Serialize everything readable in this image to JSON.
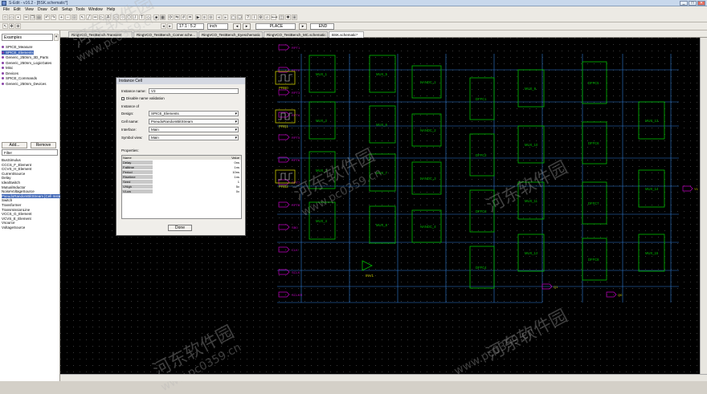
{
  "window": {
    "title": "S-Edit - v16.2 - [BSK.schematic*]",
    "min": "_",
    "max": "□",
    "close": "✕"
  },
  "menu": [
    "File",
    "Edit",
    "View",
    "Draw",
    "Cell",
    "Setup",
    "Tools",
    "Window",
    "Help"
  ],
  "toolbar": {
    "zoom_value": "17.1 : 5.2",
    "unit": "inch",
    "place_label": "PLACE",
    "end_label": "END"
  },
  "library": {
    "selected": "Examples",
    "tree": [
      {
        "label": "SPICE_Measure",
        "selected": false
      },
      {
        "label": "SPICE_Elements",
        "selected": true
      },
      {
        "label": "Generic_250nm_3D_Parts",
        "selected": false
      },
      {
        "label": "Generic_250nm_LogicGates",
        "selected": false
      },
      {
        "label": "Misc",
        "selected": false
      },
      {
        "label": "Devices",
        "selected": false
      },
      {
        "label": "SPICE_Commands",
        "selected": false
      },
      {
        "label": "Generic_250nm_Devices",
        "selected": false
      }
    ],
    "add_label": "Add...",
    "remove_label": "Remove",
    "filter_placeholder": "Filter",
    "cells": [
      {
        "label": "BusSimulus",
        "selected": false
      },
      {
        "label": "CCCS_F_Element",
        "selected": false
      },
      {
        "label": "CCVS_H_Element",
        "selected": false
      },
      {
        "label": "CurrentSource",
        "selected": false
      },
      {
        "label": "Delay",
        "selected": false
      },
      {
        "label": "IdealSwitch",
        "selected": false
      },
      {
        "label": "MutualInductor",
        "selected": false
      },
      {
        "label": "NoiseVoltageSource",
        "selected": false
      },
      {
        "label": "PseudoRandomBitStream [Cell Instance]",
        "selected": true
      },
      {
        "label": "Switch",
        "selected": false
      },
      {
        "label": "Transformer",
        "selected": false
      },
      {
        "label": "TransmissionLine",
        "selected": false
      },
      {
        "label": "VCCS_G_Element",
        "selected": false
      },
      {
        "label": "VCVS_E_Element",
        "selected": false
      },
      {
        "label": "Vsource",
        "selected": false
      },
      {
        "label": "VoltageSource",
        "selected": false
      }
    ]
  },
  "tabs": [
    {
      "label": "RingVCO_TestBench.Transient",
      "active": false
    },
    {
      "label": "RingVCO_TestBench_Corner.sche...",
      "active": false
    },
    {
      "label": "RingVCO_TestBench_Eyeschematic",
      "active": false
    },
    {
      "label": "RingVCO_TestBench_MC.schematic",
      "active": false
    },
    {
      "label": "BSK.schematic*",
      "active": true
    }
  ],
  "dialog": {
    "title": "Instance Cell",
    "instance_name_label": "Instance name:",
    "instance_name_value": "V3",
    "disable_validation_label": "Disable name validation",
    "instance_of_label": "Instance of",
    "design_label": "Design:",
    "design_value": "SPICE_Elements",
    "cell_name_label": "Cell name:",
    "cell_name_value": "PseudoRandomBitStream",
    "interface_label": "Interface:",
    "interface_value": "Main",
    "symbol_view_label": "Symbol view:",
    "symbol_view_value": "Main",
    "properties_label": "Properties:",
    "prop_header_name": "Name",
    "prop_header_value": "Value",
    "properties": [
      {
        "name": "Delay",
        "value": "0ns"
      },
      {
        "name": "Falltime",
        "value": "1ns"
      },
      {
        "name": "Period",
        "value": "10ns"
      },
      {
        "name": "Risetime",
        "value": "1ns"
      },
      {
        "name": "Seed",
        "value": "1"
      },
      {
        "name": "VHigh",
        "value": "5v"
      },
      {
        "name": "VLow",
        "value": "0v"
      }
    ],
    "done_label": "Done"
  },
  "schematic": {
    "inputs": [
      "RPT1",
      "RPT2",
      "RPT3",
      "RPT4",
      "RPT5",
      "RPT6",
      "RPT7",
      "RPT8",
      "SB0",
      "CLK",
      "SCLK",
      "SCLKR"
    ],
    "sources": [
      "PRB0",
      "PRB1",
      "PRB2"
    ],
    "mux": [
      "MUX_1",
      "MUX_2",
      "MUX_3",
      "MUX_4",
      "MUX_5",
      "MUX_6",
      "MUX_7",
      "MUX_8",
      "MUX_9",
      "MUX_10",
      "MUX_11",
      "MUX_12",
      "MUX_13",
      "MUX_14",
      "MUX_15"
    ],
    "nand": [
      "NANDC_1",
      "NANDC_2",
      "NANDC_3",
      "NANDC_4"
    ],
    "dff": [
      "DFFC1",
      "DFFC2",
      "DFFC3",
      "DFFC4",
      "DFFC5",
      "DFFC6",
      "DFFC7",
      "DFFC8"
    ],
    "inverter": "INV1",
    "outputs": [
      "Y1",
      "Q1",
      "Q0"
    ]
  },
  "watermark": [
    "河东软件园",
    "www.pc0359.cn"
  ],
  "colors": {
    "canvas": "#000000",
    "wire": "#2f7dd6",
    "module": "#00c000",
    "port": "#c000c0",
    "label": "#c8c800",
    "text": "#e0e0e0"
  }
}
